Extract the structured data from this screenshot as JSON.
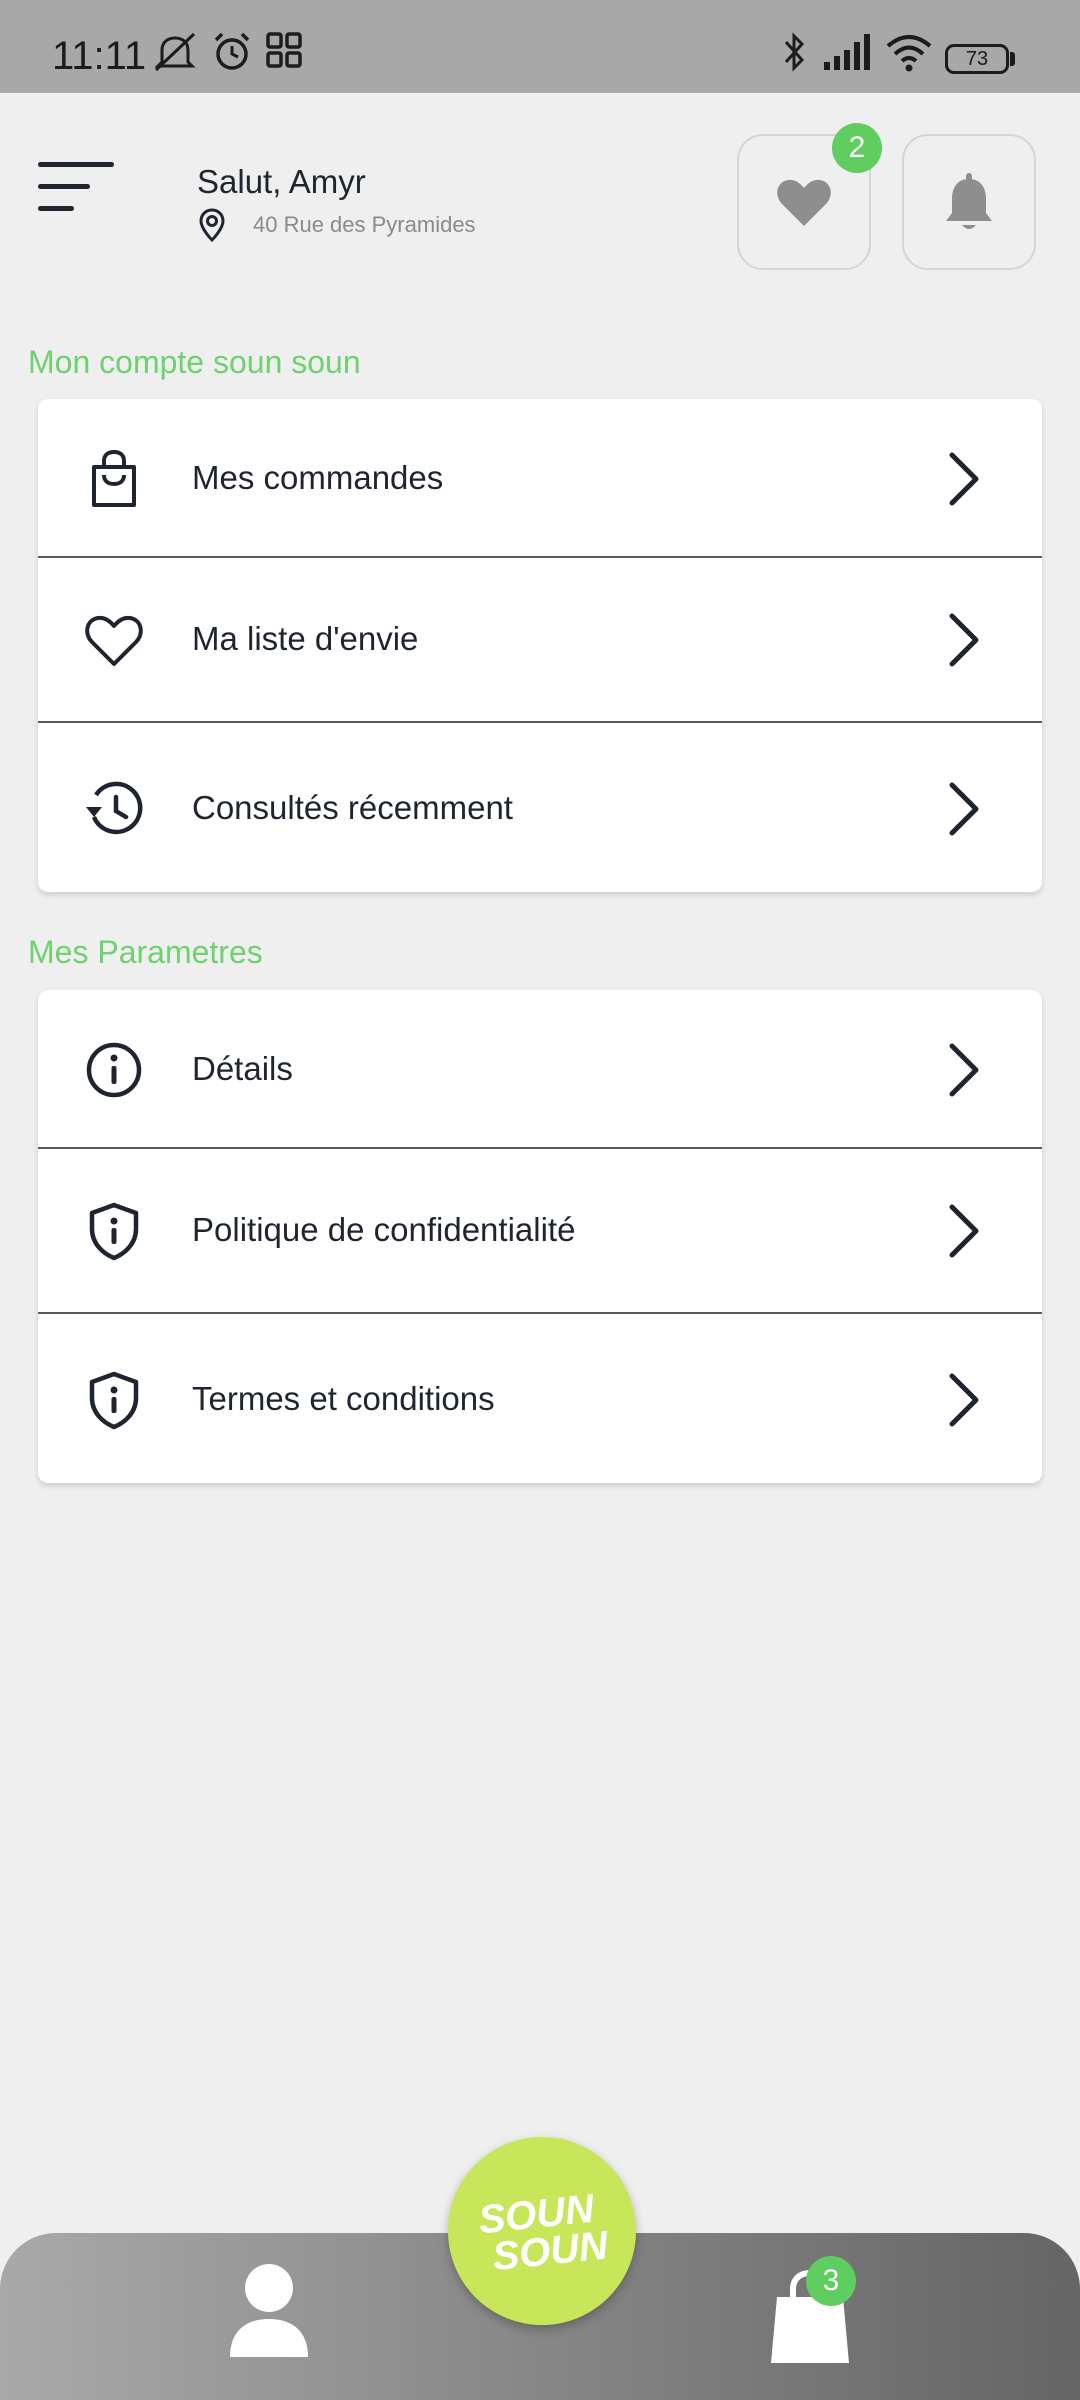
{
  "status_bar": {
    "time": "11:11",
    "battery": "73",
    "icons": [
      "mute-icon",
      "alarm-icon",
      "apps-icon",
      "bluetooth-icon",
      "signal-icon",
      "wifi-icon",
      "battery-icon"
    ]
  },
  "header": {
    "greeting": "Salut, Amyr",
    "address": "40 Rue des Pyramides",
    "favorites_badge": "2",
    "icons": [
      "menu-icon",
      "location-pin-icon",
      "heart-icon",
      "bell-icon"
    ]
  },
  "account": {
    "title": "Mon compte soun soun",
    "items": [
      {
        "label": "Mes commandes",
        "icon": "shopping-bag-icon"
      },
      {
        "label": "Ma liste d'envie",
        "icon": "heart-outline-icon"
      },
      {
        "label": "Consultés récemment",
        "icon": "history-icon"
      }
    ]
  },
  "settings": {
    "title": "Mes Parametres",
    "items": [
      {
        "label": "Détails",
        "icon": "info-icon"
      },
      {
        "label": "Politique de confidentialité",
        "icon": "shield-info-icon"
      },
      {
        "label": "Termes et conditions",
        "icon": "shield-info-icon"
      }
    ]
  },
  "bottom_nav": {
    "logo_line1": "SOUN",
    "logo_line2": "SOUN",
    "cart_badge": "3",
    "icons": [
      "user-icon",
      "cart-bag-icon"
    ]
  },
  "colors": {
    "accent_green": "#6fd16f",
    "badge_green": "#5fcd5f",
    "logo_lime": "#c8e65a",
    "text_dark": "#1f2530"
  }
}
